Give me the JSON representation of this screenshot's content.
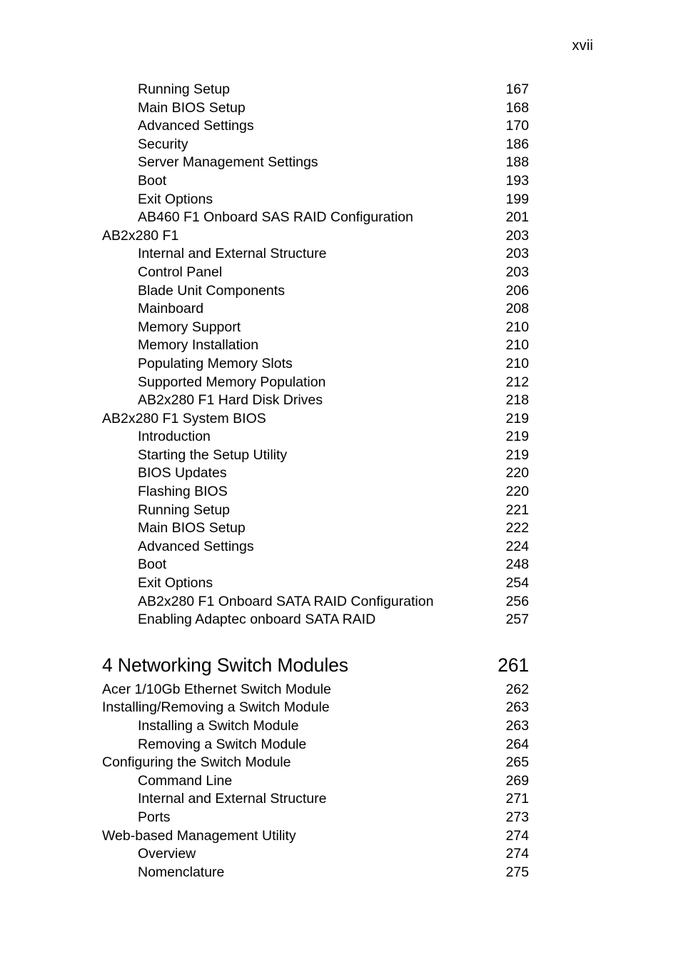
{
  "header": {
    "page_label": "xvii"
  },
  "toc": {
    "entries": [
      {
        "level": 2,
        "title": "Running Setup",
        "page": "167"
      },
      {
        "level": 2,
        "title": "Main BIOS Setup",
        "page": "168"
      },
      {
        "level": 2,
        "title": "Advanced Settings",
        "page": "170"
      },
      {
        "level": 2,
        "title": "Security",
        "page": "186"
      },
      {
        "level": 2,
        "title": "Server Management Settings",
        "page": "188"
      },
      {
        "level": 2,
        "title": "Boot",
        "page": "193"
      },
      {
        "level": 2,
        "title": "Exit Options",
        "page": "199"
      },
      {
        "level": 2,
        "title": "AB460 F1 Onboard SAS RAID Configuration",
        "page": "201"
      },
      {
        "level": 1,
        "title": "AB2x280 F1",
        "page": "203"
      },
      {
        "level": 2,
        "title": "Internal and External Structure",
        "page": "203"
      },
      {
        "level": 2,
        "title": "Control Panel",
        "page": "203"
      },
      {
        "level": 2,
        "title": "Blade Unit Components",
        "page": "206"
      },
      {
        "level": 2,
        "title": "Mainboard",
        "page": "208"
      },
      {
        "level": 2,
        "title": "Memory Support",
        "page": "210"
      },
      {
        "level": 2,
        "title": "Memory Installation",
        "page": "210"
      },
      {
        "level": 2,
        "title": "Populating Memory Slots",
        "page": "210"
      },
      {
        "level": 2,
        "title": "Supported Memory Population",
        "page": "212"
      },
      {
        "level": 2,
        "title": "AB2x280 F1 Hard Disk Drives",
        "page": "218"
      },
      {
        "level": 1,
        "title": "AB2x280 F1 System BIOS",
        "page": "219"
      },
      {
        "level": 2,
        "title": "Introduction",
        "page": "219"
      },
      {
        "level": 2,
        "title": "Starting the Setup Utility",
        "page": "219"
      },
      {
        "level": 2,
        "title": "BIOS Updates",
        "page": "220"
      },
      {
        "level": 2,
        "title": "Flashing BIOS",
        "page": "220"
      },
      {
        "level": 2,
        "title": "Running Setup",
        "page": "221"
      },
      {
        "level": 2,
        "title": "Main BIOS Setup",
        "page": "222"
      },
      {
        "level": 2,
        "title": "Advanced Settings",
        "page": "224"
      },
      {
        "level": 2,
        "title": "Boot",
        "page": "248"
      },
      {
        "level": 2,
        "title": "Exit Options",
        "page": "254"
      },
      {
        "level": 2,
        "title": "AB2x280 F1 Onboard SATA RAID Configuration",
        "page": "256"
      },
      {
        "level": 2,
        "title": "Enabling Adaptec onboard SATA RAID",
        "page": "257"
      },
      {
        "level": 0,
        "title": "4 Networking Switch Modules",
        "page": "261",
        "gap_before": true
      },
      {
        "level": 1,
        "title": "Acer 1/10Gb Ethernet Switch Module",
        "page": "262"
      },
      {
        "level": 1,
        "title": "Installing/Removing a Switch Module",
        "page": "263"
      },
      {
        "level": 2,
        "title": "Installing a Switch Module",
        "page": "263"
      },
      {
        "level": 2,
        "title": "Removing a Switch Module",
        "page": "264"
      },
      {
        "level": 1,
        "title": "Configuring the Switch Module",
        "page": "265"
      },
      {
        "level": 2,
        "title": "Command Line",
        "page": "269"
      },
      {
        "level": 2,
        "title": "Internal and External Structure",
        "page": "271"
      },
      {
        "level": 2,
        "title": "Ports",
        "page": "273"
      },
      {
        "level": 1,
        "title": "Web-based Management Utility",
        "page": "274"
      },
      {
        "level": 2,
        "title": "Overview",
        "page": "274"
      },
      {
        "level": 2,
        "title": "Nomenclature",
        "page": "275"
      }
    ]
  }
}
